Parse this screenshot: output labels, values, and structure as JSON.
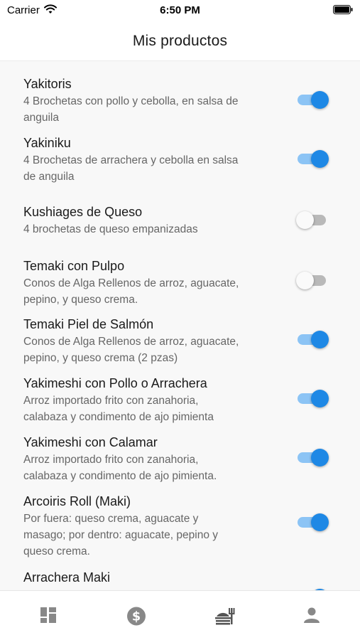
{
  "status_bar": {
    "carrier": "Carrier",
    "time": "6:50 PM"
  },
  "header": {
    "title": "Mis productos"
  },
  "products": [
    {
      "name": "Yakitoris",
      "desc_lines": [
        "4 Brochetas con pollo y cebolla, en salsa de",
        "anguila"
      ],
      "enabled": true
    },
    {
      "name": "Yakiniku",
      "desc_lines": [
        "4 Brochetas de arrachera y cebolla en salsa",
        "de anguila"
      ],
      "enabled": true
    },
    {
      "name": "Kushiages de Queso",
      "desc_lines": [
        "4 brochetas de queso empanizadas"
      ],
      "enabled": false
    },
    {
      "name": "Temaki con Pulpo",
      "desc_lines": [
        "Conos de Alga Rellenos de arroz, aguacate,",
        "pepino, y queso crema."
      ],
      "enabled": false
    },
    {
      "name": "Temaki Piel de Salmón",
      "desc_lines": [
        "Conos de Alga Rellenos de arroz, aguacate,",
        "pepino, y queso crema (2 pzas)"
      ],
      "enabled": true
    },
    {
      "name": "Yakimeshi con Pollo o Arrachera",
      "desc_lines": [
        "Arroz importado frito con zanahoria,",
        "calabaza y condimento de ajo pimienta"
      ],
      "enabled": true
    },
    {
      "name": "Yakimeshi con Calamar",
      "desc_lines": [
        "Arroz importado frito con zanahoria,",
        "calabaza y condimento de ajo pimienta."
      ],
      "enabled": true
    },
    {
      "name": "Arcoiris Roll (Maki)",
      "desc_lines": [
        "Por fuera: queso crema, aguacate y",
        "masago; por dentro: aguacate, pepino y",
        "queso crema."
      ],
      "enabled": true
    },
    {
      "name": "Arrachera Maki",
      "desc_lines": [],
      "enabled": true
    }
  ],
  "tab_bar": {
    "tabs": [
      {
        "icon": "dashboard-icon"
      },
      {
        "icon": "dollar-icon"
      },
      {
        "icon": "food-icon"
      },
      {
        "icon": "person-icon"
      }
    ]
  }
}
